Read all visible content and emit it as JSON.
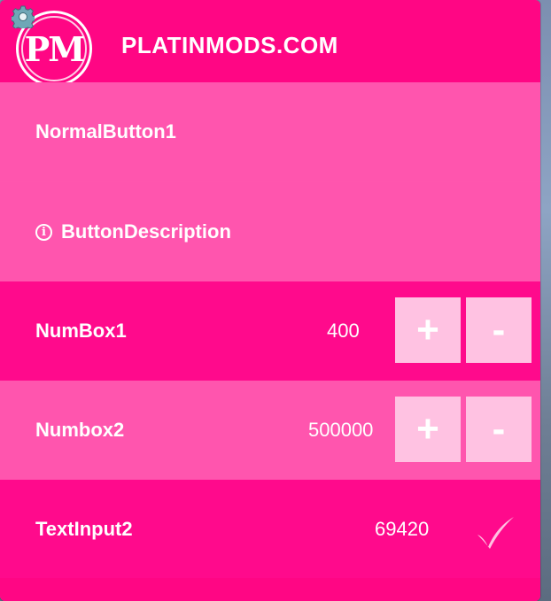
{
  "colors": {
    "header": "#ff0684",
    "row_light": "#ff55ae",
    "row_dark": "#ff0a8c",
    "button": "#ffc2e2"
  },
  "header": {
    "logo_text": "PM",
    "title": "PLATINMODS.COM",
    "settings_icon": "gear-icon"
  },
  "rows": {
    "normal_button": {
      "label": "NormalButton1"
    },
    "description": {
      "label": "ButtonDescription",
      "icon": "info-icon",
      "icon_glyph": "i"
    },
    "numbox1": {
      "label": "NumBox1",
      "value": "400",
      "plus": "+",
      "minus": "-"
    },
    "numbox2": {
      "label": "Numbox2",
      "value": "500000",
      "plus": "+",
      "minus": "-"
    },
    "text_input": {
      "label": "TextInput2",
      "value": "69420",
      "submit_icon": "checkmark-icon"
    }
  }
}
